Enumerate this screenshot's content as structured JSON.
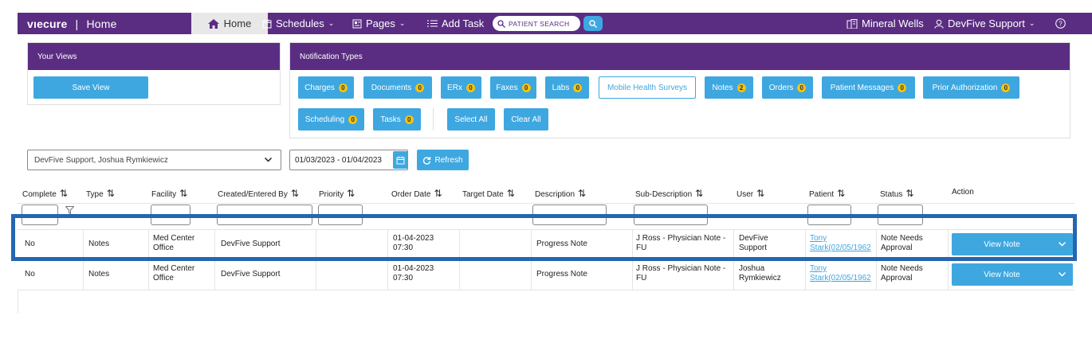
{
  "topbar": {
    "logo": "vıecure",
    "separator": "|",
    "page": "Home",
    "nav": {
      "home": "Home",
      "schedules": "Schedules",
      "pages": "Pages",
      "add_task": "Add Task",
      "patient_search_placeholder": "PATIENT SEARCH"
    },
    "location": "Mineral Wells",
    "user": "DevFive Support",
    "colors": {
      "bar": "#5a2d82",
      "accent": "#3ea7e0"
    }
  },
  "views_panel": {
    "title": "Your Views",
    "save_view": "Save View"
  },
  "notification_panel": {
    "title": "Notification Types",
    "types": [
      {
        "label": "Charges",
        "count": "0"
      },
      {
        "label": "Documents",
        "count": "0"
      },
      {
        "label": "ERx",
        "count": "0"
      },
      {
        "label": "Faxes",
        "count": "0"
      },
      {
        "label": "Labs",
        "count": "0"
      },
      {
        "label": "Mobile Health Surveys",
        "count": ""
      },
      {
        "label": "Notes",
        "count": "2"
      },
      {
        "label": "Orders",
        "count": "0"
      },
      {
        "label": "Patient Messages",
        "count": "0"
      },
      {
        "label": "Prior Authorization",
        "count": "0"
      },
      {
        "label": "Scheduling",
        "count": "0"
      },
      {
        "label": "Tasks",
        "count": "0"
      }
    ],
    "select_all": "Select All",
    "clear_all": "Clear All"
  },
  "filters": {
    "provider_select": "DevFive Support, Joshua Rymkiewicz",
    "date_range": "01/03/2023 - 01/04/2023",
    "refresh": "Refresh"
  },
  "table": {
    "headers": [
      "Complete",
      "Type",
      "Facility",
      "Created/Entered By",
      "Priority",
      "Order Date",
      "Target Date",
      "Description",
      "Sub-Description",
      "User",
      "Patient",
      "Status",
      "Action"
    ],
    "rows": [
      {
        "complete": "No",
        "type": "Notes",
        "facility": "Med Center Office",
        "created_by": "DevFive Support",
        "priority": "",
        "order_date": "01-04-2023 07:30",
        "target_date": "",
        "description": "Progress Note",
        "sub_description": "J Ross - Physician Note - FU",
        "user": "DevFive Support",
        "patient_line1": "Tony",
        "patient_line2": "Stark(02/05/1962",
        "status": "Note Needs Approval",
        "action": "View Note"
      },
      {
        "complete": "No",
        "type": "Notes",
        "facility": "Med Center Office",
        "created_by": "DevFive Support",
        "priority": "",
        "order_date": "01-04-2023 07:30",
        "target_date": "",
        "description": "Progress Note",
        "sub_description": "J Ross - Physician Note - FU",
        "user": "Joshua Rymkiewicz",
        "patient_line1": "Tony",
        "patient_line2": "Stark(02/05/1962",
        "status": "Note Needs Approval",
        "action": "View Note"
      }
    ]
  }
}
